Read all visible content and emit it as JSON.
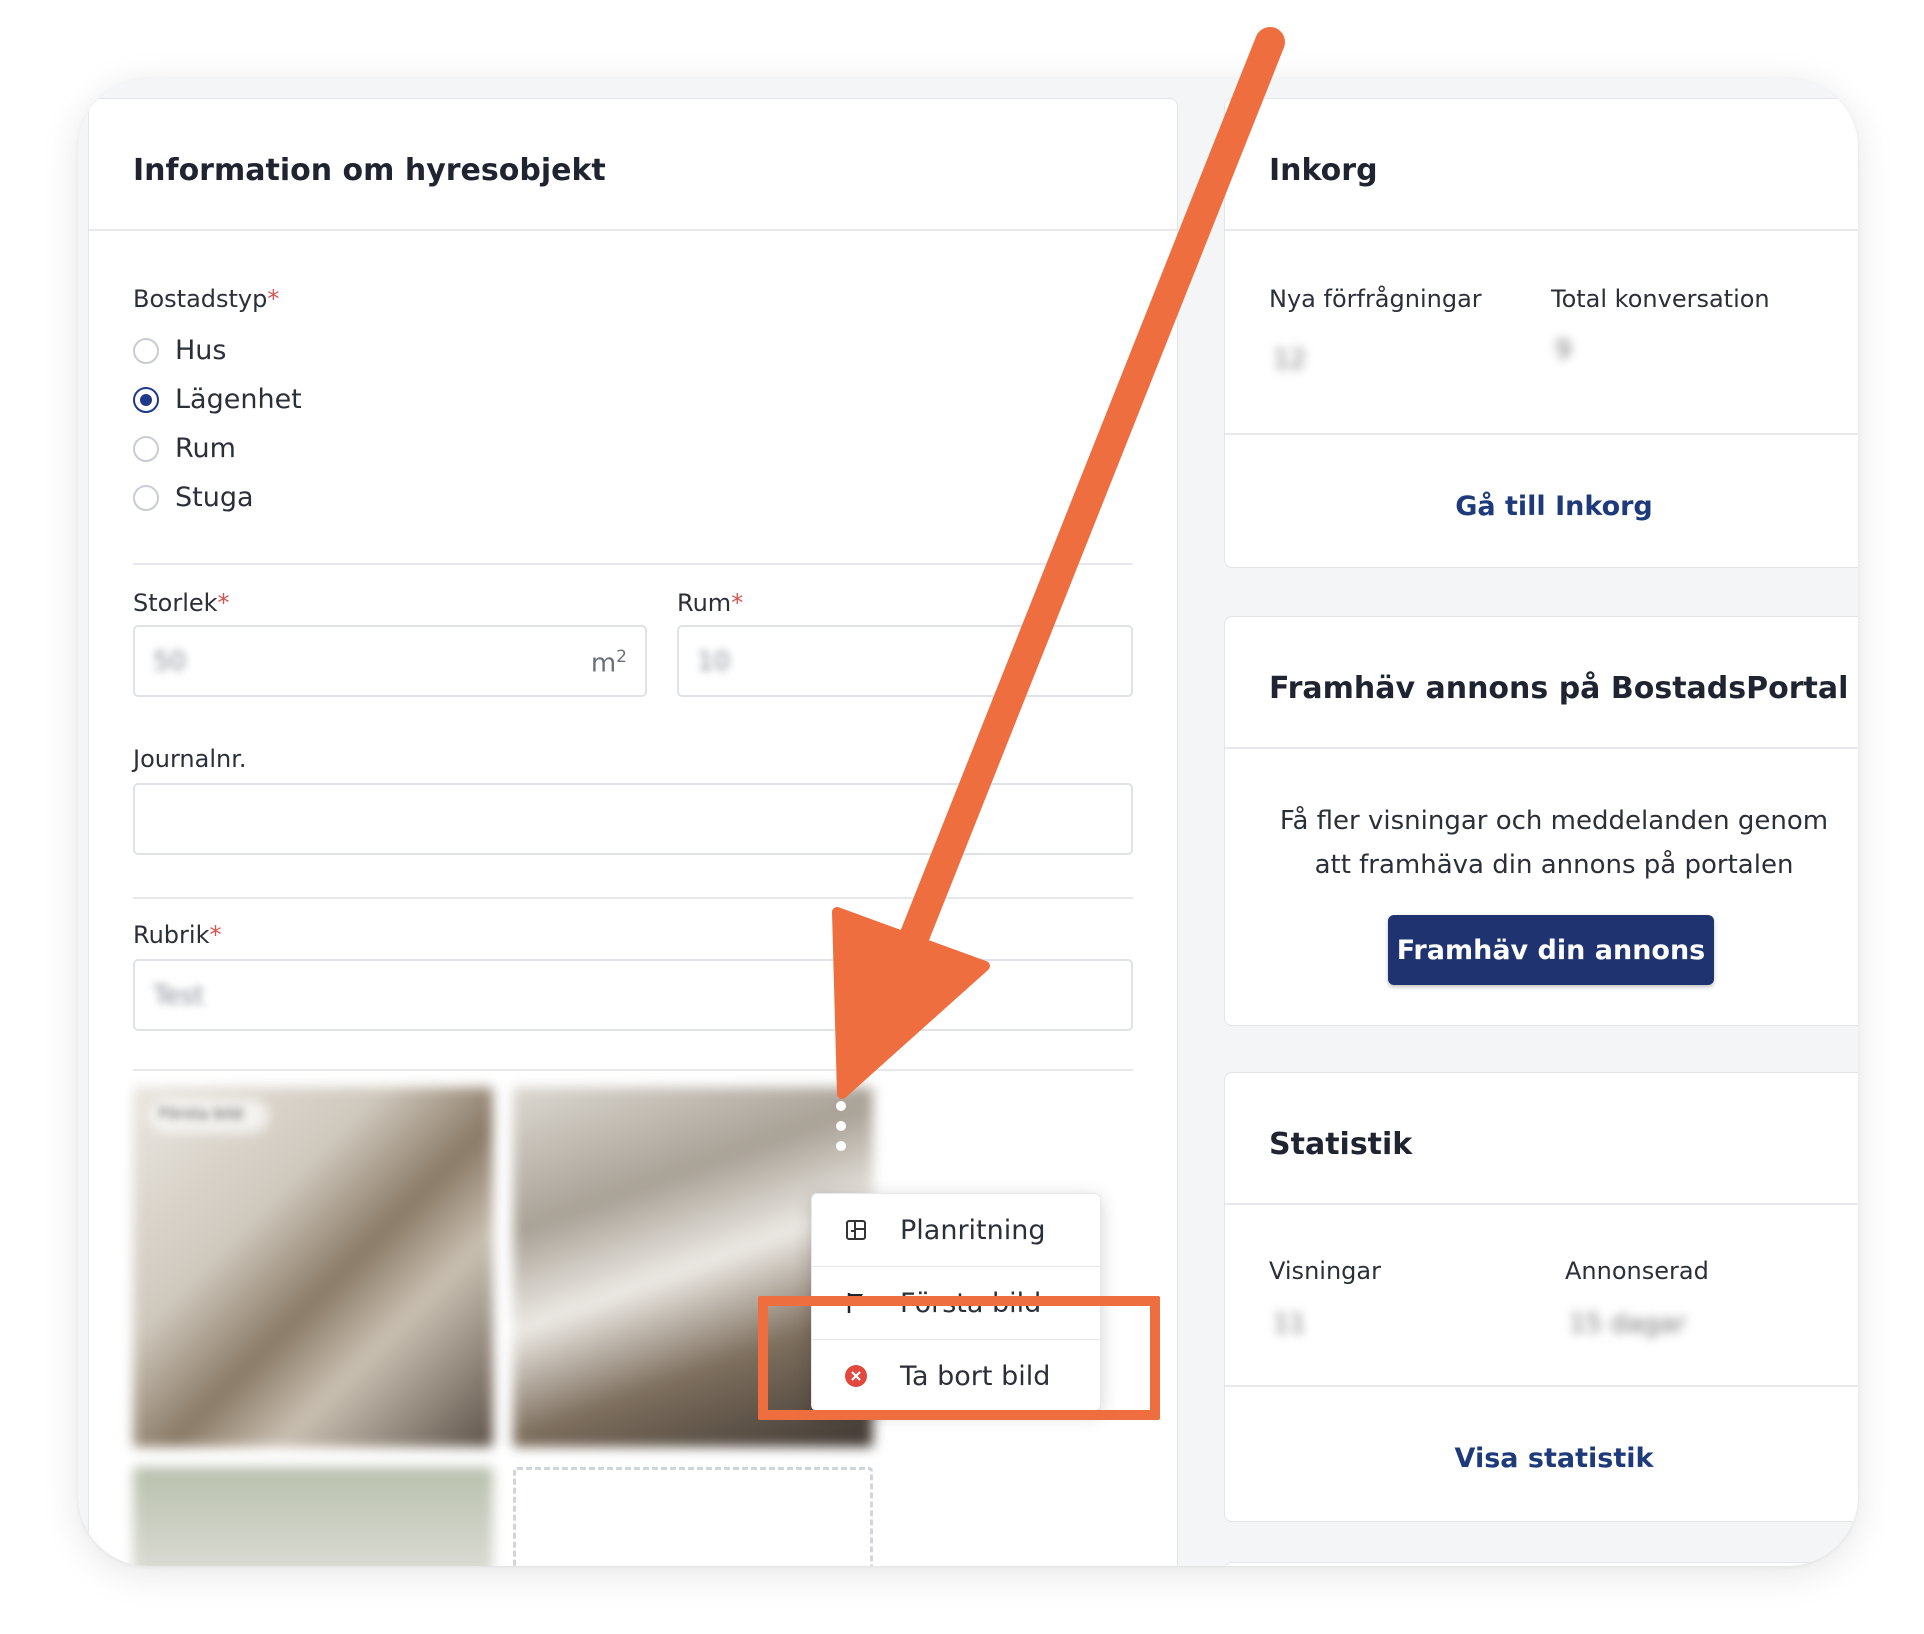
{
  "left_card": {
    "title": "Information om hyresobjekt",
    "housing_type": {
      "label": "Bostadstyp",
      "required_mark": "*",
      "options": [
        {
          "label": "Hus",
          "selected": false
        },
        {
          "label": "Lägenhet",
          "selected": true
        },
        {
          "label": "Rum",
          "selected": false
        },
        {
          "label": "Stuga",
          "selected": false
        }
      ]
    },
    "size": {
      "label": "Storlek",
      "required_mark": "*",
      "value": "50",
      "unit": "m",
      "unit_sup": "2"
    },
    "rooms": {
      "label": "Rum",
      "required_mark": "*",
      "value": "10"
    },
    "journal": {
      "label": "Journalnr.",
      "value": ""
    },
    "headline": {
      "label": "Rubrik",
      "required_mark": "*",
      "value": "Test"
    },
    "photos": {
      "first_badge": "Första bild"
    },
    "context_menu": {
      "items": [
        {
          "label": "Planritning",
          "icon": "floorplan-icon"
        },
        {
          "label": "Första bild",
          "icon": "flag-icon"
        },
        {
          "label": "Ta bort bild",
          "icon": "remove-circle-icon"
        }
      ]
    }
  },
  "inbox_card": {
    "title": "Inkorg",
    "new_requests_label": "Nya förfrågningar",
    "new_requests_value": "12",
    "total_conv_label": "Total konversation",
    "total_conv_value": "9",
    "link": "Gå till Inkorg"
  },
  "promote_card": {
    "title": "Framhäv annons på BostadsPortal",
    "text_line1": "Få fler visningar och meddelanden genom",
    "text_line2": "att framhäva din annons på portalen",
    "button": "Framhäv din annons"
  },
  "stats_card": {
    "title": "Statistik",
    "views_label": "Visningar",
    "views_value": "11",
    "advertised_label": "Annonserad",
    "advertised_value": "15 dagar",
    "link": "Visa statistik"
  },
  "colors": {
    "accent": "#1f3371",
    "annotation": "#ef6e3f",
    "required": "#d9534f",
    "remove_icon": "#e0493b"
  }
}
